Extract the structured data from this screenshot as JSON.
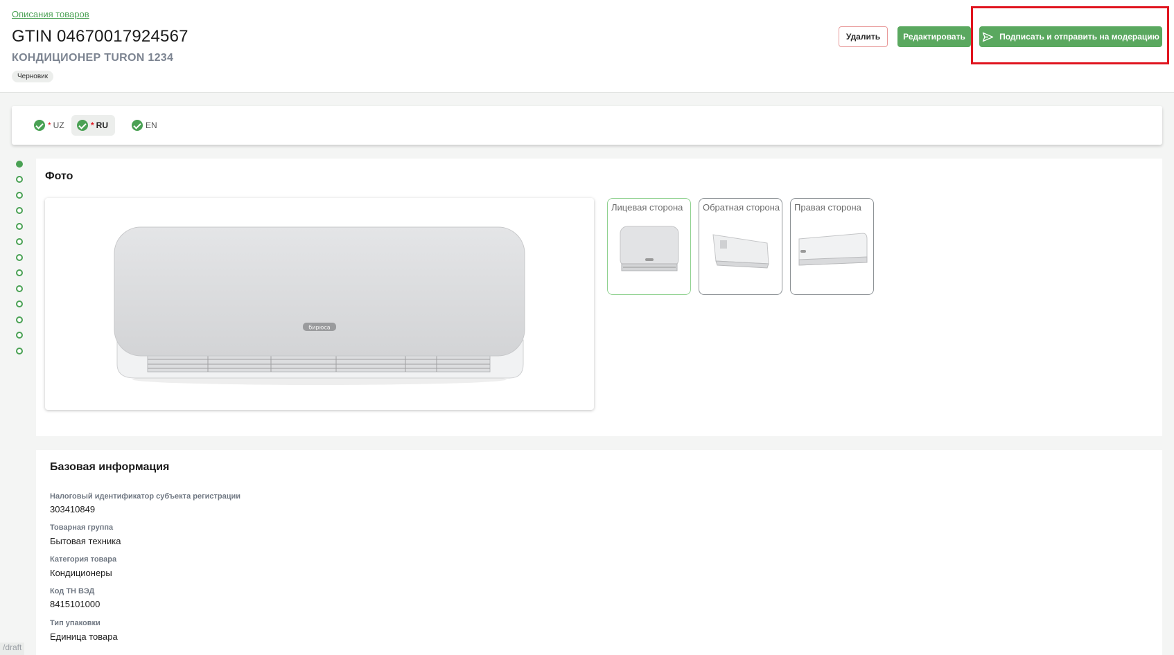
{
  "header": {
    "breadcrumb": "Описания товаров",
    "title": "GTIN 04670017924567",
    "subtitle": "КОНДИЦИОНЕР TURON 1234",
    "status": "Черновик",
    "buttons": {
      "delete": "Удалить",
      "edit": "Редактировать",
      "sign": "Подписать и отправить на модерацию"
    }
  },
  "languages": [
    {
      "code": "UZ",
      "required": true,
      "active": false
    },
    {
      "code": "RU",
      "required": true,
      "active": true
    },
    {
      "code": "EN",
      "required": false,
      "active": false
    }
  ],
  "photo": {
    "title": "Фото",
    "brand": "бирюса",
    "thumbnails": [
      "Лицевая сторона",
      "Обратная сторона",
      "Правая сторона"
    ]
  },
  "basic_info": {
    "title": "Базовая информация",
    "fields": [
      {
        "label": "Налоговый идентификатор субъекта регистрации",
        "value": "303410849"
      },
      {
        "label": "Товарная группа",
        "value": "Бытовая техника"
      },
      {
        "label": "Категория товара",
        "value": "Кондиционеры"
      },
      {
        "label": "Код ТН ВЭД",
        "value": "8415101000"
      },
      {
        "label": "Тип упаковки",
        "value": "Единица товара"
      }
    ]
  },
  "footer": {
    "route_hint": "/draft"
  },
  "colors": {
    "accent": "#5aa85f",
    "highlight": "#e0141e",
    "danger_border": "#e89a9a"
  }
}
